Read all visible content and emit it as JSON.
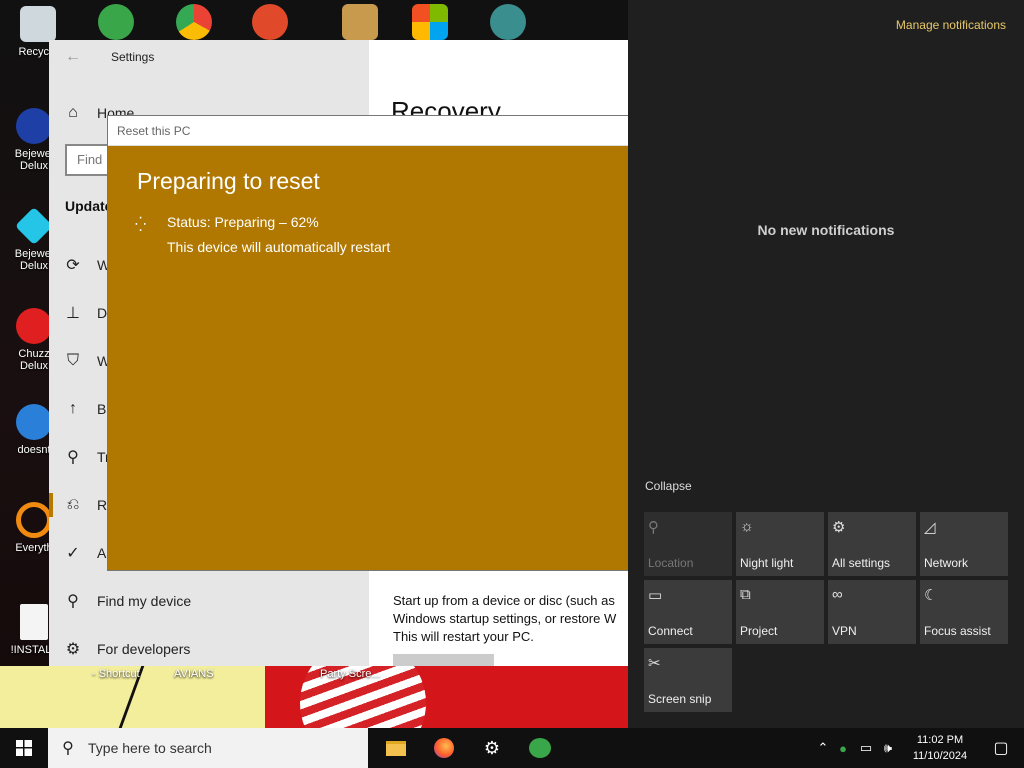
{
  "desktop": {
    "icons": [
      {
        "label": "Recycle"
      },
      {
        "label": "Bejewel Delux"
      },
      {
        "label": "Bejewel Delux"
      },
      {
        "label": "Chuzz Delux"
      },
      {
        "label": "doesnt"
      },
      {
        "label": "Everyth"
      },
      {
        "label": "!INSTALL"
      }
    ],
    "bottom_labels": [
      "- Shortcut",
      "AVIANS",
      "Party Scre..."
    ]
  },
  "settings": {
    "window_title": "Settings",
    "home_label": "Home",
    "find_placeholder": "Find",
    "section_heading": "Update",
    "page_title": "Recovery",
    "nav_items": [
      {
        "label": "W",
        "icon": "sync-icon"
      },
      {
        "label": "De",
        "icon": "delivery-icon"
      },
      {
        "label": "W",
        "icon": "shield-icon"
      },
      {
        "label": "Ba",
        "icon": "backup-icon"
      },
      {
        "label": "Tr",
        "icon": "wrench-icon"
      },
      {
        "label": "Re",
        "icon": "recovery-icon"
      },
      {
        "label": "Ac",
        "icon": "activation-icon"
      },
      {
        "label": "Find my device",
        "icon": "person-pin-icon"
      },
      {
        "label": "For developers",
        "icon": "developer-icon"
      }
    ],
    "advanced_text": [
      "Start up from a device or disc (such as",
      "Windows startup settings, or restore W",
      "This will restart your PC."
    ]
  },
  "reset_dialog": {
    "title": "Reset this PC",
    "heading": "Preparing to reset",
    "status": "Status: Preparing – 62%",
    "progress_percent": 62,
    "restart_note": "This device will automatically restart",
    "bg_color": "#b07800"
  },
  "action_center": {
    "manage_label": "Manage notifications",
    "empty_text": "No new notifications",
    "collapse_label": "Collapse",
    "tiles": [
      {
        "label": "Location",
        "icon": "location-icon",
        "enabled": false
      },
      {
        "label": "Night light",
        "icon": "sun-icon",
        "enabled": true
      },
      {
        "label": "All settings",
        "icon": "gear-icon",
        "enabled": true
      },
      {
        "label": "Network",
        "icon": "network-icon",
        "enabled": true
      },
      {
        "label": "Connect",
        "icon": "connect-icon",
        "enabled": true
      },
      {
        "label": "Project",
        "icon": "project-icon",
        "enabled": true
      },
      {
        "label": "VPN",
        "icon": "vpn-icon",
        "enabled": true
      },
      {
        "label": "Focus assist",
        "icon": "moon-icon",
        "enabled": true
      },
      {
        "label": "Screen snip",
        "icon": "snip-icon",
        "enabled": true
      }
    ]
  },
  "taskbar": {
    "search_placeholder": "Type here to search",
    "apps": [
      "file-explorer-icon",
      "firefox-icon",
      "settings-gear-icon",
      "messenger-icon"
    ],
    "time": "11:02 PM",
    "date": "11/10/2024"
  }
}
